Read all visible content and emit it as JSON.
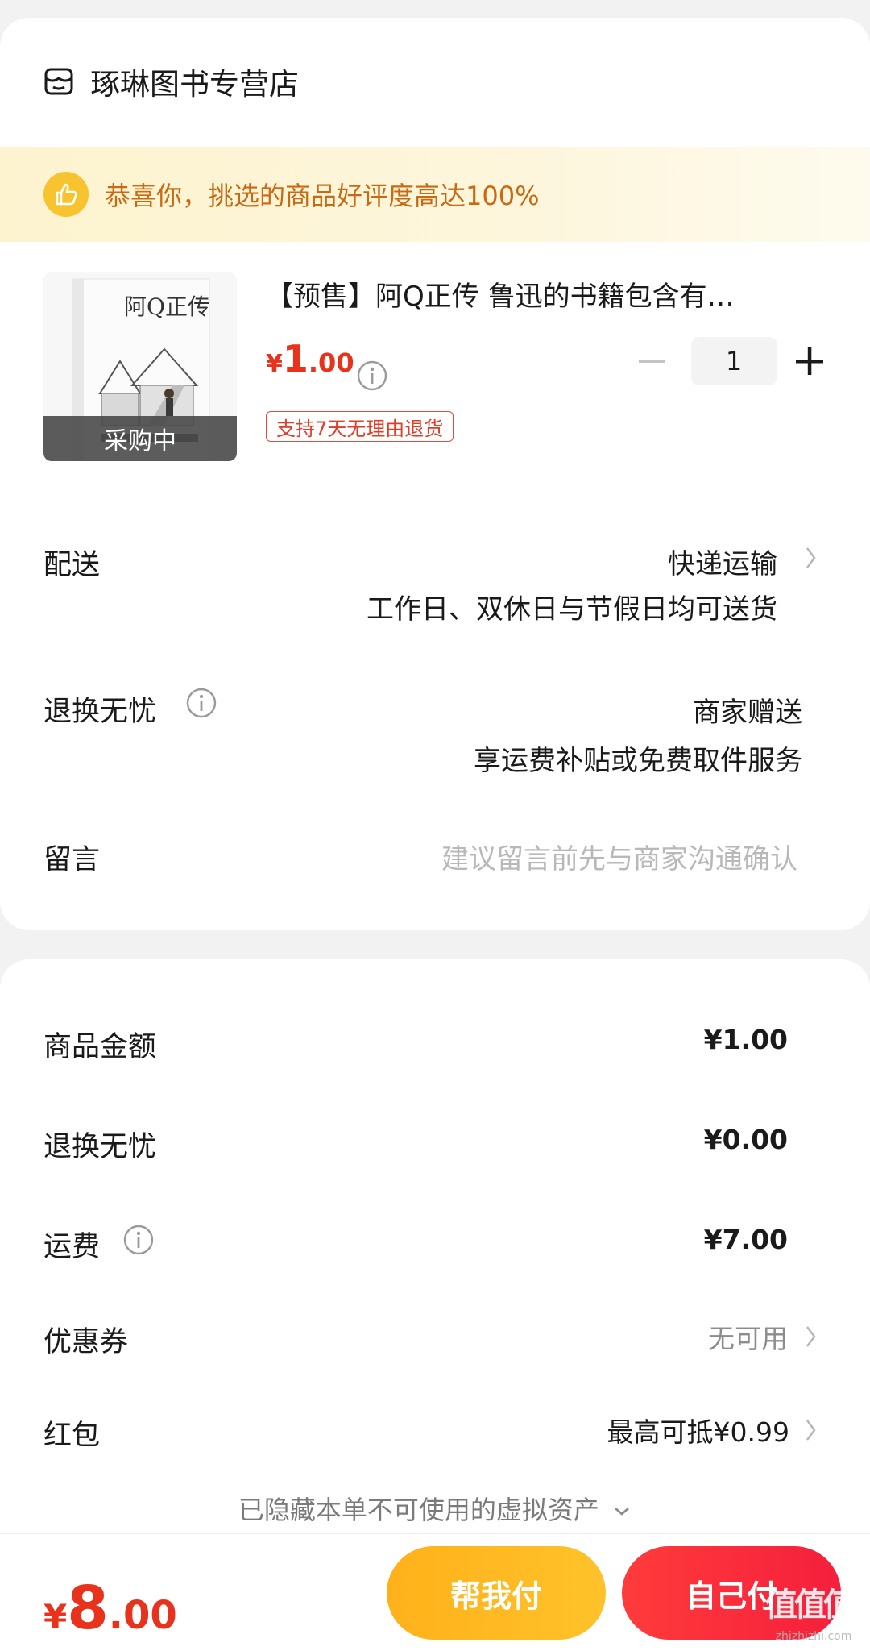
{
  "store": {
    "name": "琢琳图书专营店",
    "icon": "store-icon"
  },
  "banner": {
    "text": "恭喜你，挑选的商品好评度高达100%",
    "icon": "thumbs-up-icon"
  },
  "product": {
    "title": "【预售】阿Q正传 鲁迅的书籍包含有…",
    "cover_title": "阿Q正传",
    "status_label": "采购中",
    "price_currency": "¥",
    "price_int": "1",
    "price_dec": ".00",
    "quantity": "1",
    "return_tag": "支持7天无理由退货"
  },
  "delivery": {
    "label": "配送",
    "method": "快递运输",
    "note": "工作日、双休日与节假日均可送货"
  },
  "worry_free": {
    "label": "退换无忧",
    "provider": "商家赠送",
    "note": "享运费补贴或免费取件服务"
  },
  "message": {
    "label": "留言",
    "placeholder": "建议留言前先与商家沟通确认"
  },
  "summary": {
    "goods_label": "商品金额",
    "goods_value": "¥1.00",
    "worry_label": "退换无忧",
    "worry_value": "¥0.00",
    "shipping_label": "运费",
    "shipping_value": "¥7.00",
    "coupon_label": "优惠券",
    "coupon_value": "无可用",
    "redpacket_label": "红包",
    "redpacket_value": "最高可抵¥0.99",
    "hidden_assets": "已隐藏本单不可使用的虚拟资产"
  },
  "footer": {
    "total_currency": "¥",
    "total_int": "8",
    "total_dec": ".00",
    "help_pay": "帮我付",
    "self_pay": "自己付",
    "watermark": "值值值",
    "watermark_sub": "zhizhizhi.com"
  },
  "colors": {
    "accent_red": "#e8321c",
    "banner_text": "#c96a12",
    "yellow_button": "#ffb11a",
    "red_button": "#f51f3c"
  }
}
